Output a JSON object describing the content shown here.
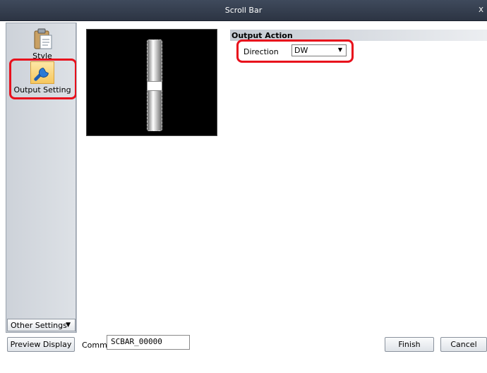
{
  "window": {
    "title": "Scroll Bar",
    "close_glyph": "x"
  },
  "sidebar": {
    "items": [
      {
        "label": "Style",
        "icon": "clipboard-icon"
      },
      {
        "label": "Output Setting",
        "icon": "wrench-icon"
      }
    ],
    "other_settings_label": "Other Settings"
  },
  "output_action": {
    "header": "Output Action",
    "direction_label": "Direction",
    "direction_value": "DW"
  },
  "footer": {
    "preview_label": "Preview Display",
    "comment_label": "Comme",
    "comment_value": "SCBAR_00000",
    "finish_label": "Finish",
    "cancel_label": "Cancel"
  },
  "colors": {
    "highlight": "#e8101c",
    "titlebar": "#2c3443",
    "preview_background": "#000000"
  }
}
